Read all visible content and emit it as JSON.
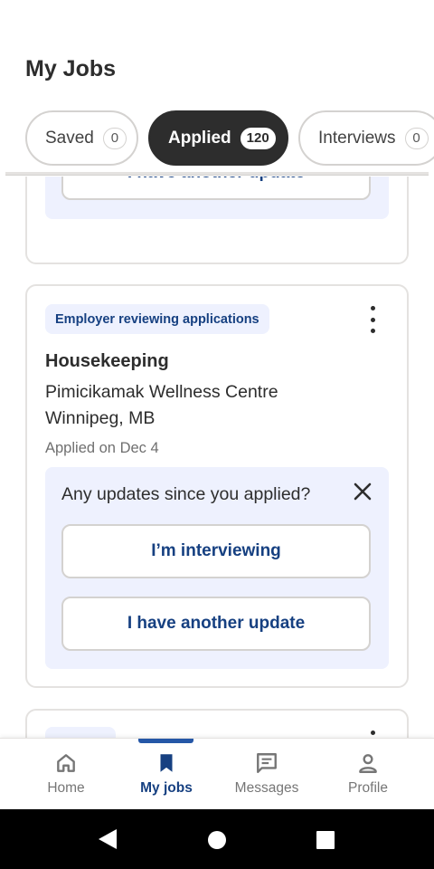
{
  "header": {
    "title": "My Jobs"
  },
  "tabs": [
    {
      "label": "Saved",
      "count": "0"
    },
    {
      "label": "Applied",
      "count": "120"
    },
    {
      "label": "Interviews",
      "count": "0"
    }
  ],
  "cards": {
    "previous": {
      "update_button": "I have another update"
    },
    "current": {
      "status": "Employer reviewing applications",
      "title": "Housekeeping",
      "company": "Pimicikamak Wellness Centre",
      "location": "Winnipeg, MB",
      "applied_date": "Applied on Dec 4",
      "question": "Any updates since you applied?",
      "interviewing_button": "I’m interviewing",
      "update_button": "I have another update"
    }
  },
  "nav": {
    "items": [
      {
        "label": "Home",
        "icon": "home-icon"
      },
      {
        "label": "My jobs",
        "icon": "bookmark-icon",
        "active": true
      },
      {
        "label": "Messages",
        "icon": "message-icon"
      },
      {
        "label": "Profile",
        "icon": "person-icon"
      }
    ]
  },
  "colors": {
    "accent": "#164081",
    "accent_light": "#eef1fe",
    "dark": "#2d2d2d",
    "indicator": "#2557a7"
  }
}
